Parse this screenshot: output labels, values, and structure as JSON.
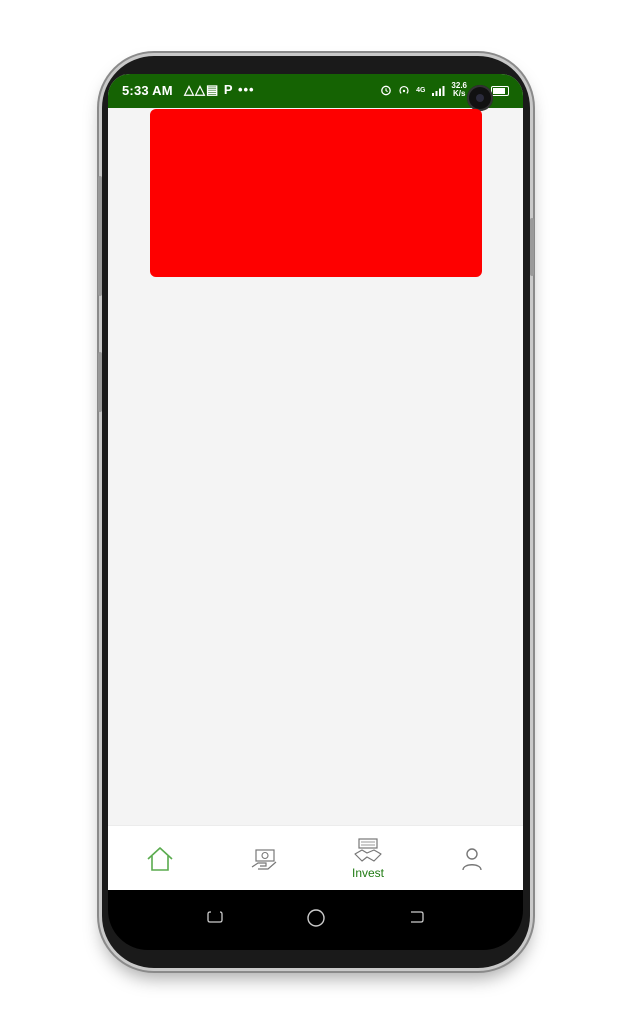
{
  "status_bar": {
    "time": "5:33 AM",
    "indicators": "△△▤ P •••",
    "network_speed_top": "32.6",
    "network_speed_bottom": "K/s",
    "network_type": "4G",
    "bg_color": "#156303"
  },
  "banner": {
    "color": "#fe0000"
  },
  "bottom_nav": {
    "items": [
      {
        "icon": "home-icon",
        "label": "",
        "active": false
      },
      {
        "icon": "money-hand-icon",
        "label": "",
        "active": false
      },
      {
        "icon": "invest-handshake-icon",
        "label": "Invest",
        "active": true
      },
      {
        "icon": "profile-icon",
        "label": "",
        "active": false
      }
    ],
    "active_color": "#1f7a12"
  },
  "android_nav": [
    "recents-icon",
    "home-circle-icon",
    "back-icon"
  ]
}
